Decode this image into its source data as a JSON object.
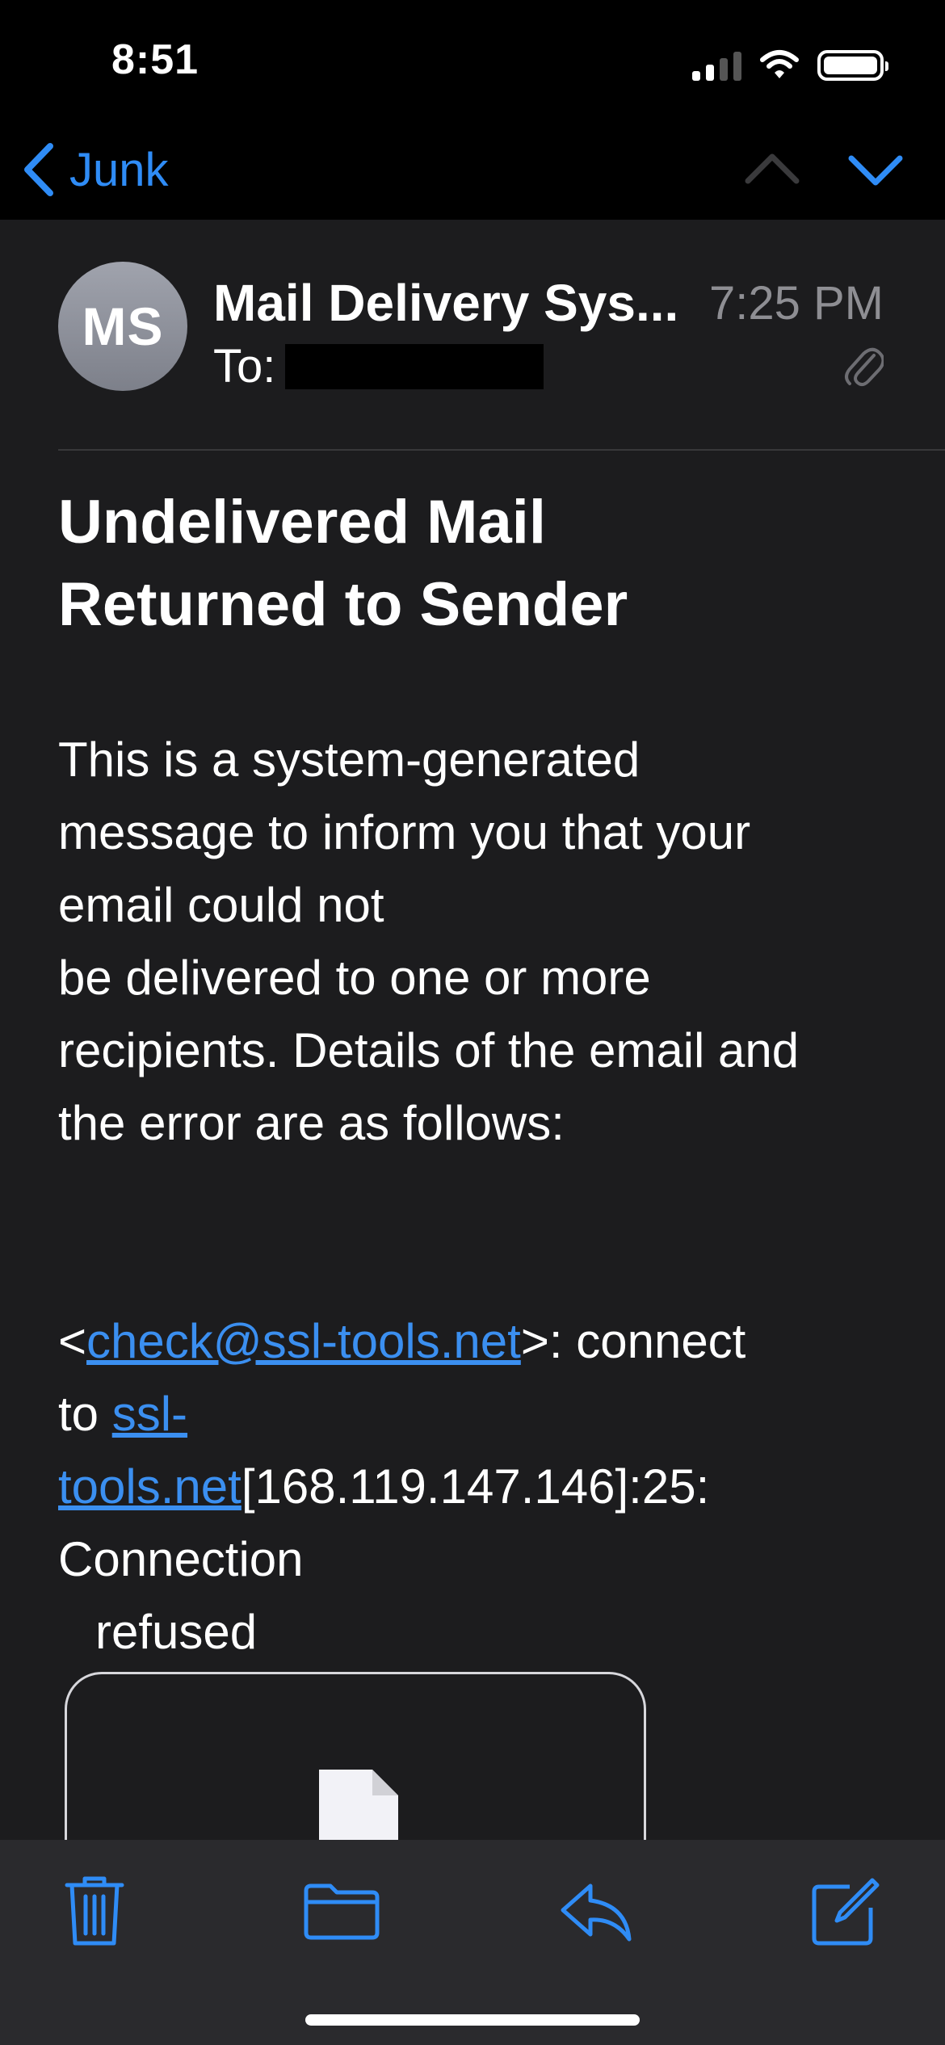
{
  "status_bar": {
    "time": "8:51"
  },
  "nav": {
    "back_label": "Junk"
  },
  "message": {
    "avatar_initials": "MS",
    "sender": "Mail Delivery Sys...",
    "time": "7:25 PM",
    "to_label": "To:",
    "subject_line1": "Undelivered Mail",
    "subject_line2": "Returned to Sender",
    "body": {
      "line1": "This is a system-generated",
      "line2": "message to inform you that your",
      "line3": "email could not",
      "line4": "be delivered to one or more",
      "line5": "recipients. Details of the email and",
      "line6": "the error are as follows:",
      "err_open": "<",
      "err_email": "check@ssl-tools.net",
      "err_after_email": ">: connect",
      "err_to": "to ",
      "err_host_part1": "ssl-",
      "err_host_part2": "tools.net",
      "err_address": "[168.119.147.146]:25:",
      "err_connection": "Connection",
      "err_refused": "refused"
    }
  },
  "icons": {
    "back": "chevron-left-icon",
    "prev": "chevron-up-icon",
    "next": "chevron-down-icon",
    "attachment": "paperclip-icon",
    "document": "document-icon",
    "trash": "trash-icon",
    "folder": "folder-icon",
    "reply": "reply-icon",
    "compose": "compose-icon"
  },
  "colors": {
    "accent": "#2f8cf6",
    "background": "#1c1c1e",
    "bars": "#000000",
    "toolbar": "#2a2a2d",
    "secondary_text": "#8e8e93"
  }
}
